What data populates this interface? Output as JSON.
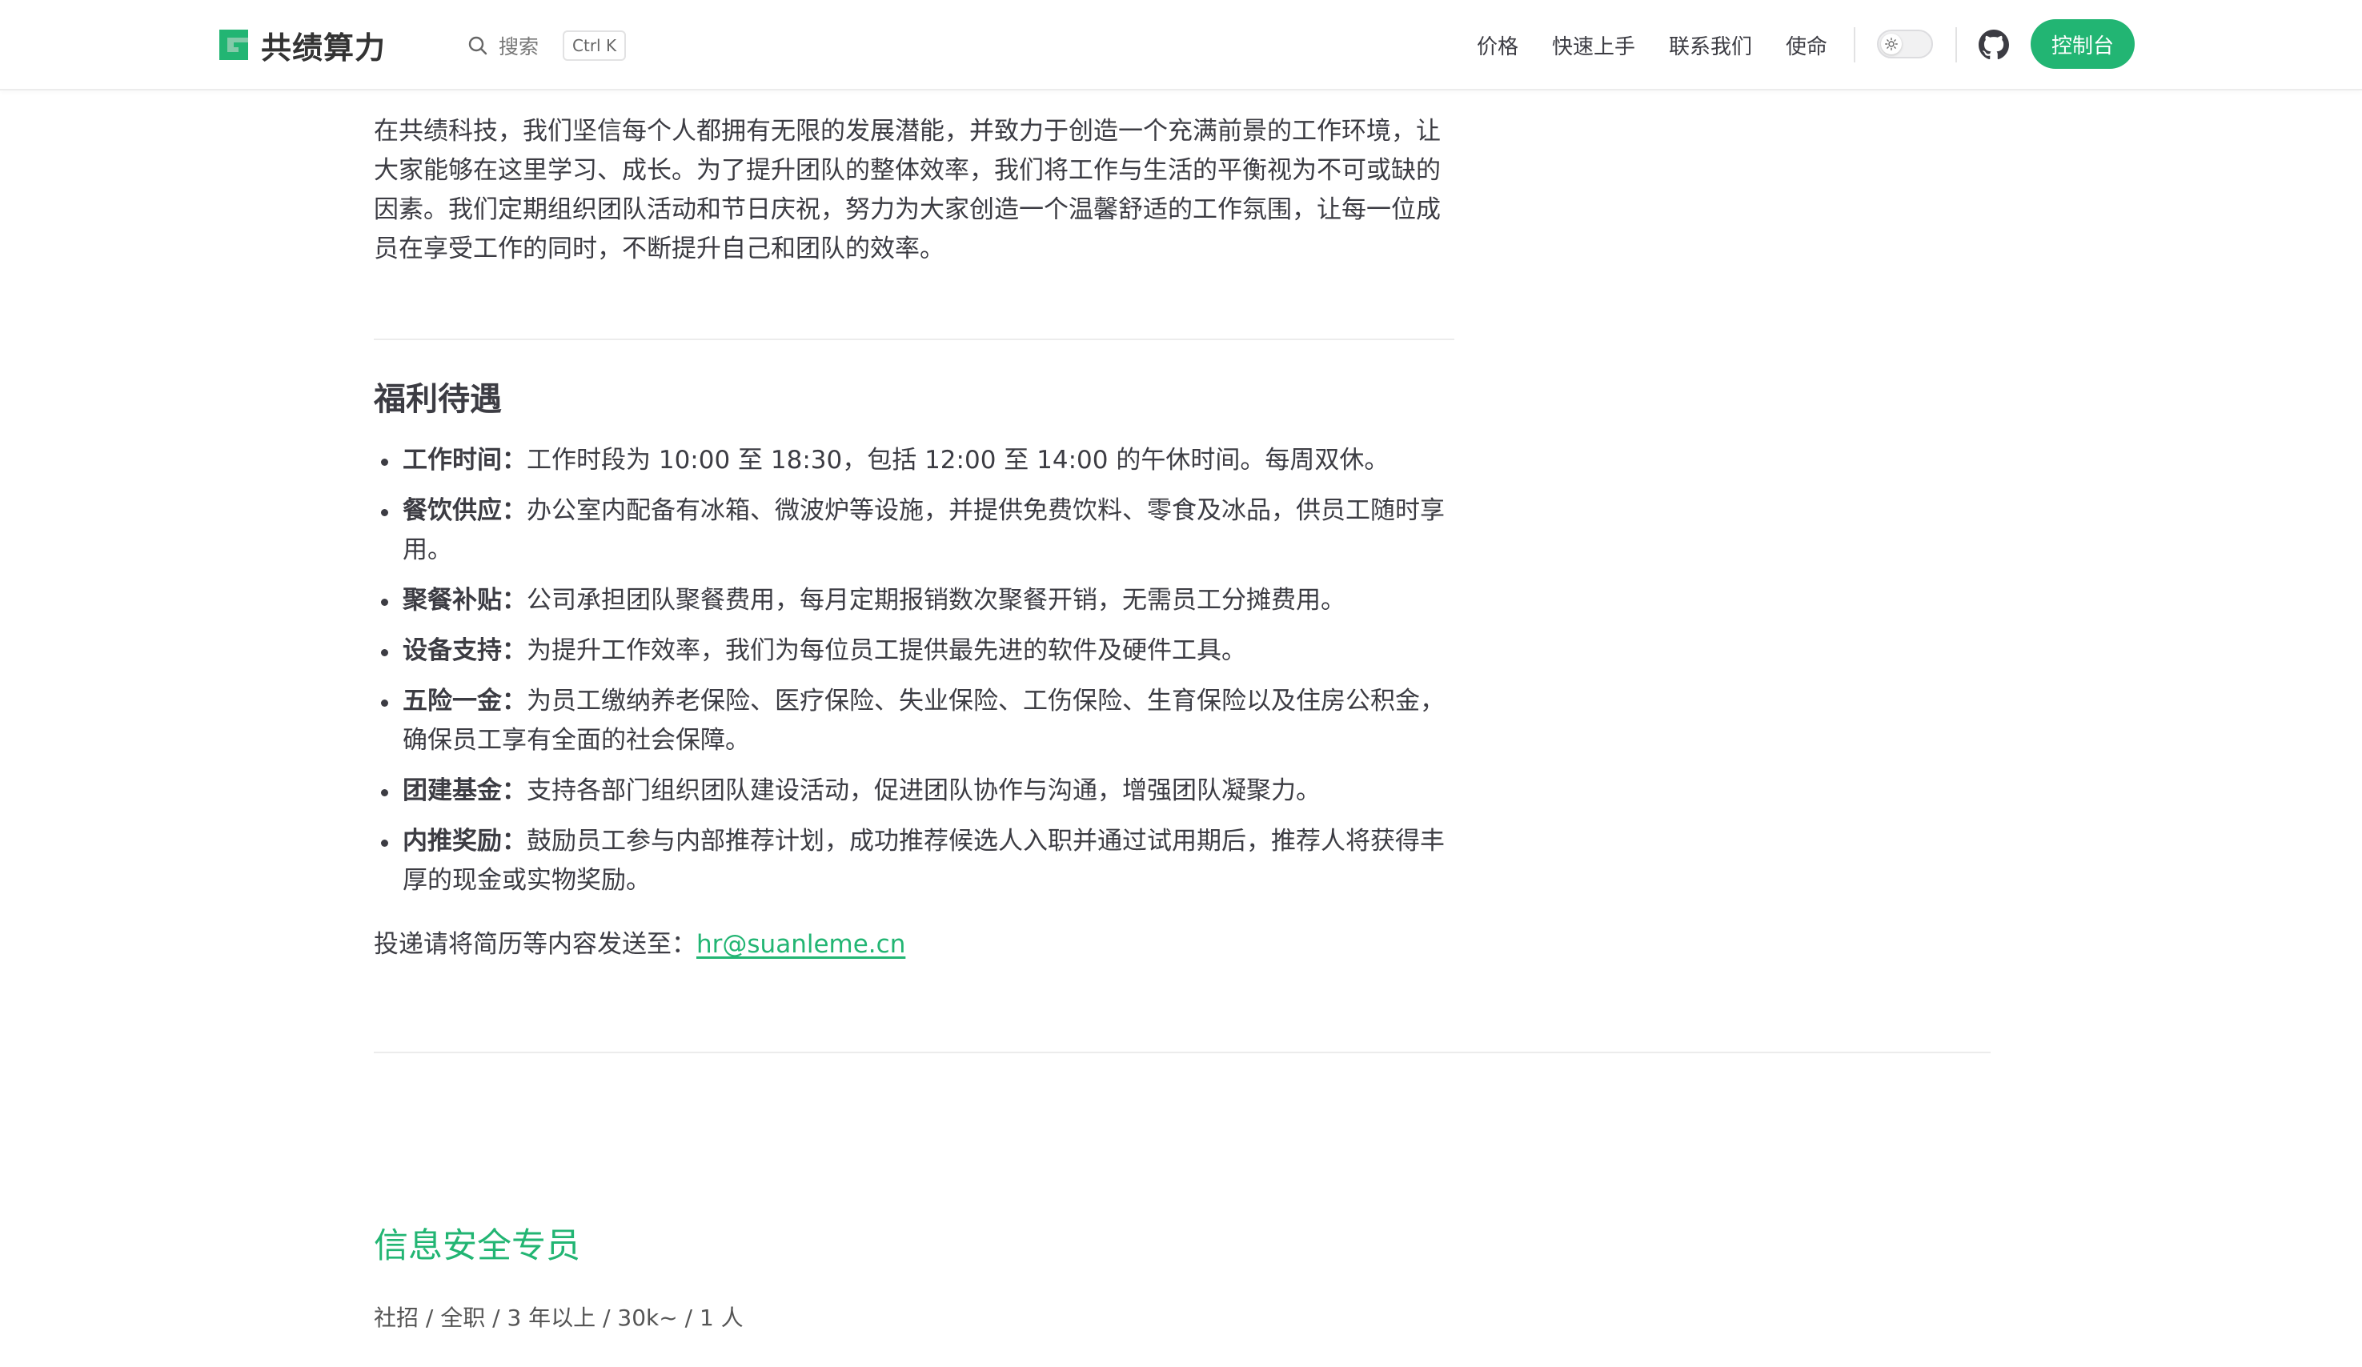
{
  "header": {
    "logo_text": "共绩算力",
    "search_label": "搜索",
    "search_shortcut": "Ctrl K",
    "nav": [
      "价格",
      "快速上手",
      "联系我们",
      "使命"
    ],
    "console_label": "控制台",
    "accent_color": "#22b573"
  },
  "intro": "在共绩科技，我们坚信每个人都拥有无限的发展潜能，并致力于创造一个充满前景的工作环境，让大家能够在这里学习、成长。为了提升团队的整体效率，我们将工作与生活的平衡视为不可或缺的因素。我们定期组织团队活动和节日庆祝，努力为大家创造一个温馨舒适的工作氛围，让每一位成员在享受工作的同时，不断提升自己和团队的效率。",
  "benefits_section": {
    "title": "福利待遇",
    "items": [
      {
        "key": "工作时间：",
        "text": "工作时段为 10:00 至 18:30，包括 12:00 至 14:00 的午休时间。每周双休。"
      },
      {
        "key": "餐饮供应：",
        "text": "办公室内配备有冰箱、微波炉等设施，并提供免费饮料、零食及冰品，供员工随时享用。"
      },
      {
        "key": "聚餐补贴：",
        "text": "公司承担团队聚餐费用，每月定期报销数次聚餐开销，无需员工分摊费用。"
      },
      {
        "key": "设备支持：",
        "text": "为提升工作效率，我们为每位员工提供最先进的软件及硬件工具。"
      },
      {
        "key": "五险一金：",
        "text": "为员工缴纳养老保险、医疗保险、失业保险、工伤保险、生育保险以及住房公积金，确保员工享有全面的社会保障。"
      },
      {
        "key": "团建基金：",
        "text": "支持各部门组织团队建设活动，促进团队协作与沟通，增强团队凝聚力。"
      },
      {
        "key": "内推奖励：",
        "text": "鼓励员工参与内部推荐计划，成功推荐候选人入职并通过试用期后，推荐人将获得丰厚的现金或实物奖励。"
      }
    ]
  },
  "contact": {
    "prefix": "投递请将简历等内容发送至：",
    "email": "hr@suanleme.cn"
  },
  "next_job": {
    "title": "信息安全专员",
    "meta": "社招 / 全职 / 3 年以上 / 30k~ / 1 人"
  },
  "icons": {
    "search": "search-icon",
    "theme": "sun-icon",
    "github": "github-icon"
  }
}
